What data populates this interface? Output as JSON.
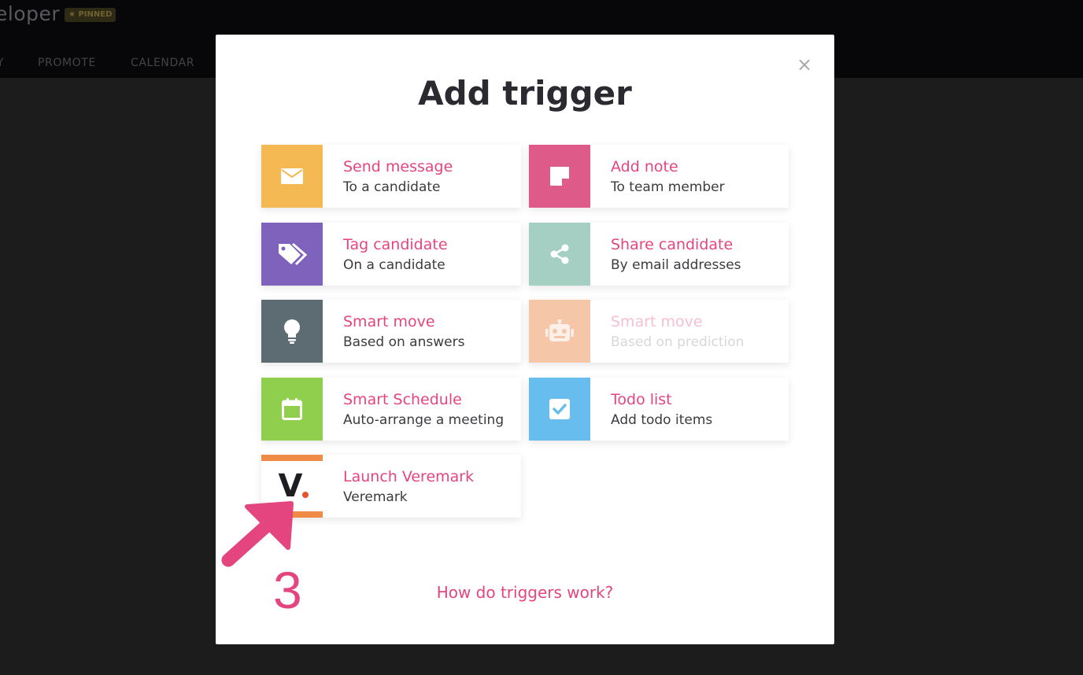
{
  "app": {
    "title": "eloper",
    "pinned_badge": "PINNED",
    "nav": [
      "Y",
      "PROMOTE",
      "CALENDAR"
    ]
  },
  "modal": {
    "title": "Add trigger",
    "close_label": "×",
    "help_link": "How do triggers work?"
  },
  "cards": [
    {
      "title": "Send message",
      "subtitle": "To a candidate",
      "color": "#f5b953",
      "icon": "envelope-icon"
    },
    {
      "title": "Add note",
      "subtitle": "To team member",
      "color": "#de5a89",
      "icon": "note-icon"
    },
    {
      "title": "Tag candidate",
      "subtitle": "On a candidate",
      "color": "#7f62bc",
      "icon": "tags-icon"
    },
    {
      "title": "Share candidate",
      "subtitle": "By email addresses",
      "color": "#a5cfc3",
      "icon": "share-icon"
    },
    {
      "title": "Smart move",
      "subtitle": "Based on answers",
      "color": "#5d6b72",
      "icon": "lightbulb-icon"
    },
    {
      "title": "Smart move",
      "subtitle": "Based on prediction",
      "color": "#f6c6a9",
      "icon": "robot-icon",
      "disabled": true
    },
    {
      "title": "Smart Schedule",
      "subtitle": "Auto-arrange a meeting",
      "color": "#8fcf4d",
      "icon": "calendar-icon"
    },
    {
      "title": "Todo list",
      "subtitle": "Add todo items",
      "color": "#67bdee",
      "icon": "checkbox-icon"
    },
    {
      "title": "Launch Veremark",
      "subtitle": "Veremark",
      "color": "#f08b47",
      "icon": "veremark-logo-icon",
      "logo_text": "V"
    }
  ],
  "annotation": {
    "step_number": "3",
    "arrow_color": "#e5457e"
  }
}
